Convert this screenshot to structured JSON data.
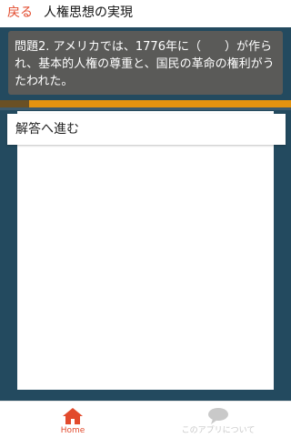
{
  "header": {
    "back_label": "戻る",
    "title": "人権思想の実現"
  },
  "question": {
    "text": "問題2. アメリカでは、1776年に（　　）が作られ、基本的人権の尊重と、国民の革命の権利がうたわれた。"
  },
  "progress": {
    "fraction": 0.1
  },
  "answer": {
    "button_label": "解答へ進む"
  },
  "bottom_nav": {
    "items": [
      {
        "label": "Home",
        "icon": "home-icon",
        "active": true
      },
      {
        "label": "このアプリについて",
        "icon": "chat-bubble-icon",
        "active": false
      }
    ]
  },
  "colors": {
    "accent": "#e24a2c",
    "panel": "#234a5f",
    "question_bg": "#5a5a58",
    "progress_bar": "#e4930f",
    "progress_fill": "#6a5024",
    "inactive": "#c9c9c9"
  }
}
